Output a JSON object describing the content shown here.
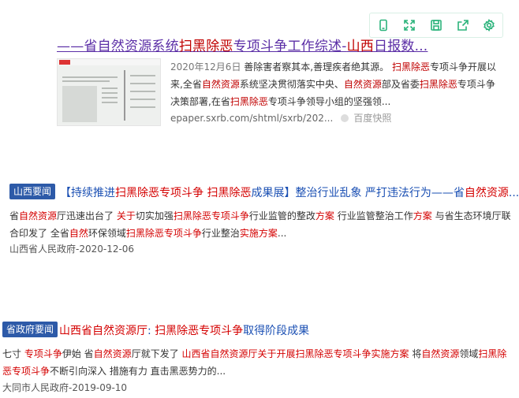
{
  "toolbar": {
    "icons": [
      "mobile-icon",
      "expand-icon",
      "save-icon",
      "share-icon",
      "settings-icon"
    ],
    "accent": "#2bb37b"
  },
  "result1": {
    "title_parts": [
      "——省",
      "自然资源",
      "系统",
      "扫黑除恶",
      "专项斗争工作综述-",
      "山西",
      "日报数..."
    ],
    "date": "2020年12月6日",
    "snippet_parts": [
      "善除害者察其本,善理疾者绝其源。",
      "扫黑除恶",
      "专项斗争开展以来,全省",
      "自然资源",
      "系统坚决贯彻落实中央、",
      "自然资源",
      "部及省委",
      "扫黑除恶",
      "专项斗争决策部署,在省",
      "扫黑除恶",
      "专项斗争领导小组的坚强领..."
    ],
    "url": "epaper.sxrb.com/shtml/sxrb/202...",
    "cache_label": "百度快照"
  },
  "result2": {
    "badge": "山西要闻",
    "title_parts": [
      "【持续推进",
      "扫黑除恶专项斗争",
      " ",
      "扫黑除恶",
      "成果展】整治行业乱象 严打违法行为——省",
      "自然资源",
      "..."
    ],
    "snippet_parts": [
      "省",
      "自然资源",
      "厅迅速出台了 ",
      "关于",
      "切实加强",
      "扫黑除恶专项斗争",
      "行业监管的整改",
      "方案",
      " 行业监管整治工作",
      "方案",
      " 与省生态环境厅联合印发了 全省",
      "自然",
      "环保领域",
      "扫黑除恶专项斗争",
      "行业整治",
      "实施方案",
      "..."
    ],
    "source": "山西省人民政府-2020-12-06"
  },
  "result3": {
    "badge": "省政府要闻",
    "title_parts": [
      "山西省自然资源厅",
      ": ",
      "扫黑除恶专项斗争",
      "取得阶段成果"
    ],
    "snippet_parts": [
      "七寸 ",
      "专项斗争",
      "伊始 省",
      "自然资源",
      "厅就下发了 ",
      "山西省自然资源厅关于开展扫黑除恶专项斗争实施方案",
      " 将",
      "自然资源",
      "领域",
      "扫黑除恶专项斗争",
      "不断引向深入 措施有力 直击黑恶势力的..."
    ],
    "source": "大同市人民政府-2019-09-10"
  }
}
